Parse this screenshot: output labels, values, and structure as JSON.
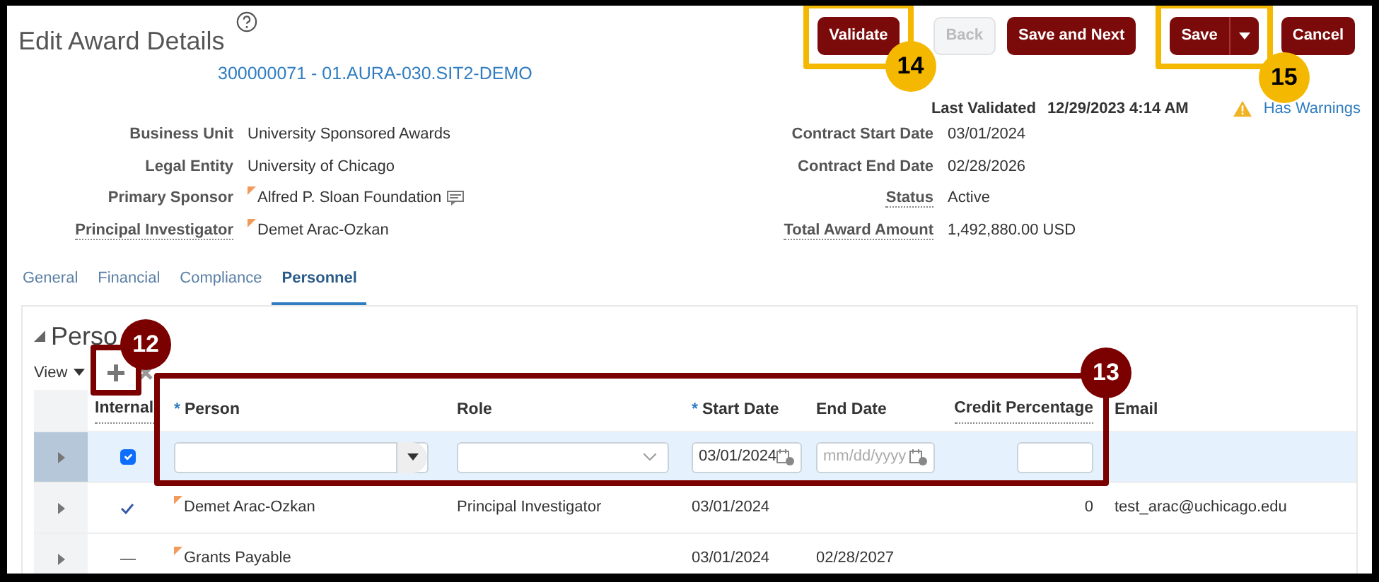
{
  "header": {
    "title": "Edit Award Details",
    "record_link": "300000071 - 01.AURA-030.SIT2-DEMO",
    "buttons": [
      {
        "label": "Validate",
        "kind": "primary"
      },
      {
        "label": "Back",
        "kind": "disabled"
      },
      {
        "label": "Save and Next",
        "kind": "primary"
      },
      {
        "label": "Save",
        "kind": "split"
      },
      {
        "label": "Cancel",
        "kind": "primary"
      }
    ],
    "last_validated_label": "Last Validated",
    "last_validated_value": "12/29/2023 4:14 AM",
    "warning": "Has Warnings"
  },
  "details_left": [
    {
      "label": "Business Unit",
      "value": "University Sponsored Awards",
      "has_help": false,
      "flagged": false,
      "note_icon": false
    },
    {
      "label": "Legal Entity",
      "value": "University of Chicago",
      "has_help": false,
      "flagged": false,
      "note_icon": false
    },
    {
      "label": "Primary Sponsor",
      "value": "Alfred P. Sloan Foundation",
      "has_help": false,
      "flagged": true,
      "note_icon": true
    },
    {
      "label": "Principal Investigator",
      "value": "Demet Arac-Ozkan",
      "has_help": true,
      "flagged": true,
      "note_icon": false
    }
  ],
  "details_right": [
    {
      "label": "Contract Start Date",
      "value": "03/01/2024",
      "has_help": false
    },
    {
      "label": "Contract End Date",
      "value": "02/28/2026",
      "has_help": false
    },
    {
      "label": "Status",
      "value": "Active",
      "has_help": true
    },
    {
      "label": "Total Award Amount",
      "value": "1,492,880.00  USD",
      "has_help": true
    }
  ],
  "tabs": [
    {
      "label": "General",
      "selected": false
    },
    {
      "label": "Financial",
      "selected": false
    },
    {
      "label": "Compliance",
      "selected": false
    },
    {
      "label": "Personnel",
      "selected": true
    }
  ],
  "section": {
    "title": "Perso",
    "expanded": true,
    "view_menu": "View"
  },
  "table": {
    "columns": [
      {
        "label": "Internal",
        "has_help": true
      },
      {
        "label": "Person",
        "marker": "*",
        "has_help": false
      },
      {
        "label": "Role",
        "has_help": false
      },
      {
        "label": "Start Date",
        "marker": "*",
        "has_help": false
      },
      {
        "label": "End Date",
        "has_help": false
      },
      {
        "label": "Credit Percentage",
        "has_help": true
      },
      {
        "label": "Email",
        "has_help": false
      }
    ],
    "rows": [
      {
        "kind": "edit",
        "selected": true,
        "internal": true,
        "start_value": "03/01/2024",
        "end_placeholder": "mm/dd/yyyy"
      },
      {
        "kind": "view",
        "selected": false,
        "internal": true,
        "person": "Demet Arac-Ozkan",
        "role": "Principal Investigator",
        "start": "03/01/2024",
        "credit": "0",
        "email": "test_arac@uchicago.edu"
      },
      {
        "kind": "view",
        "selected": false,
        "internal": false,
        "person": "Grants Payable",
        "start": "03/01/2024",
        "end": "02/28/2027"
      }
    ]
  },
  "callouts": [
    {
      "number": "12",
      "color": "#7b0000"
    },
    {
      "number": "13",
      "color": "#7b0000"
    },
    {
      "number": "14",
      "color": "#f5b800"
    },
    {
      "number": "15",
      "color": "#f5b800"
    }
  ]
}
